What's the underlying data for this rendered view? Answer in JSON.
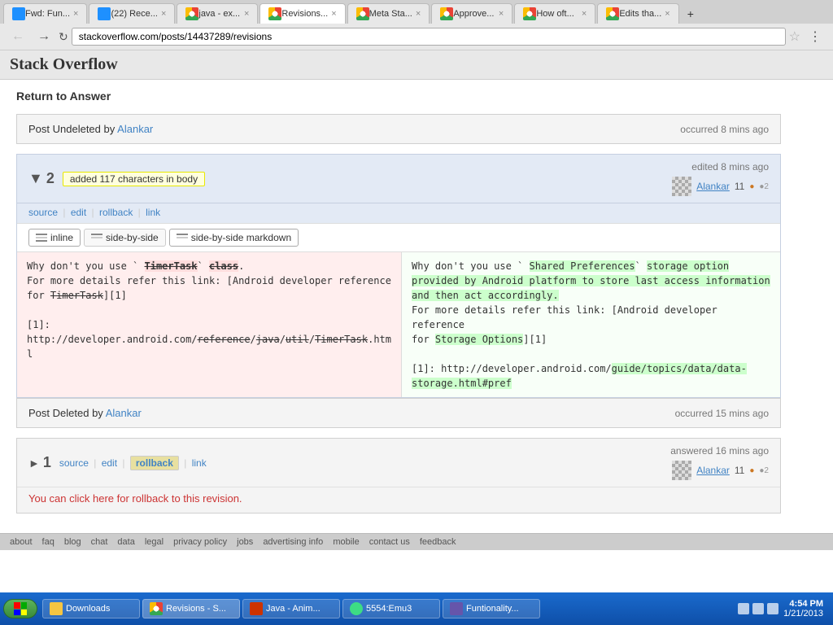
{
  "browser": {
    "tabs": [
      {
        "id": "t1",
        "title": "Fwd: Fun...",
        "favicon": "mail",
        "active": false
      },
      {
        "id": "t2",
        "title": "(22) Rece...",
        "favicon": "mail",
        "active": false
      },
      {
        "id": "t3",
        "title": "java - ex...",
        "favicon": "so",
        "active": false
      },
      {
        "id": "t4",
        "title": "Revisions...",
        "favicon": "so",
        "active": true
      },
      {
        "id": "t5",
        "title": "Meta Sta...",
        "favicon": "so",
        "active": false
      },
      {
        "id": "t6",
        "title": "Approve...",
        "favicon": "so",
        "active": false
      },
      {
        "id": "t7",
        "title": "How oft...",
        "favicon": "so",
        "active": false
      },
      {
        "id": "t8",
        "title": "Edits tha...",
        "favicon": "so",
        "active": false
      }
    ],
    "url": "stackoverflow.com/posts/14437289/revisions"
  },
  "page": {
    "site_title": "Stack Overflow",
    "return_link": "Return to Answer",
    "revisions": [
      {
        "type": "undelete",
        "action": "Post Undeleted",
        "by_label": "by",
        "user": "Alankar",
        "time_label": "occurred 8 mins ago"
      },
      {
        "type": "edit",
        "number": "2",
        "pill_text": "added 117 characters in body",
        "links": [
          "source",
          "edit",
          "rollback",
          "link"
        ],
        "edit_label": "edited 8 mins ago",
        "user": "Alankar",
        "rep": "11",
        "badge_orange": "●",
        "badge_silver": "●2",
        "diff": {
          "tabs": [
            "inline",
            "side-by-side",
            "side-by-side markdown"
          ],
          "left": {
            "line1": "Why don't you use `  TimerTask`  class.",
            "line2": "For more details refer this link: [Android developer reference",
            "line3": "for  TimerTask][1]",
            "line4": "",
            "line5": "[1]:",
            "line6": "http://developer.android.com/reference/java/util/TimerTask.htm",
            "line7": "l"
          },
          "right": {
            "line1": "Why don't you use `   Shared Preferences`  storage option",
            "line2": "provided by Android platform to store last access information",
            "line3": "and then act accordingly.",
            "line4": "For more details refer this link: [Android developer reference",
            "line5": "for  Storage Options][1]",
            "line6": "",
            "line7": "[1]: http://developer.android.com/guide/topics/data/data-",
            "line8": "storage.html#pref"
          }
        }
      },
      {
        "type": "delete",
        "action": "Post Deleted",
        "by_label": "by",
        "user": "Alankar",
        "time_label": "occurred 15 mins ago"
      },
      {
        "type": "initial",
        "number": "1",
        "links": [
          "source",
          "edit",
          "rollback",
          "link"
        ],
        "answered_label": "answered 16 mins ago",
        "user": "Alankar",
        "rep": "11",
        "badge_orange": "●",
        "badge_silver": "●2",
        "rollback_msg": "You can click here for rollback to this revision."
      }
    ]
  },
  "footer_links": [
    "about",
    "faq",
    "blog",
    "chat",
    "data",
    "legal",
    "privacy policy",
    "jobs",
    "advertising info",
    "mobile",
    "contact us",
    "feedback"
  ],
  "taskbar": {
    "items": [
      {
        "label": "Downloads",
        "icon": "folder",
        "active": false
      },
      {
        "label": "Revisions - S...",
        "icon": "chrome",
        "active": true
      },
      {
        "label": "Java - Anim...",
        "icon": "java",
        "active": false
      },
      {
        "label": "5554:Emu3",
        "icon": "android",
        "active": false
      },
      {
        "label": "Funtionality...",
        "icon": "game",
        "active": false
      }
    ],
    "clock": {
      "time": "4:54 PM",
      "date": "1/21/2013"
    }
  }
}
